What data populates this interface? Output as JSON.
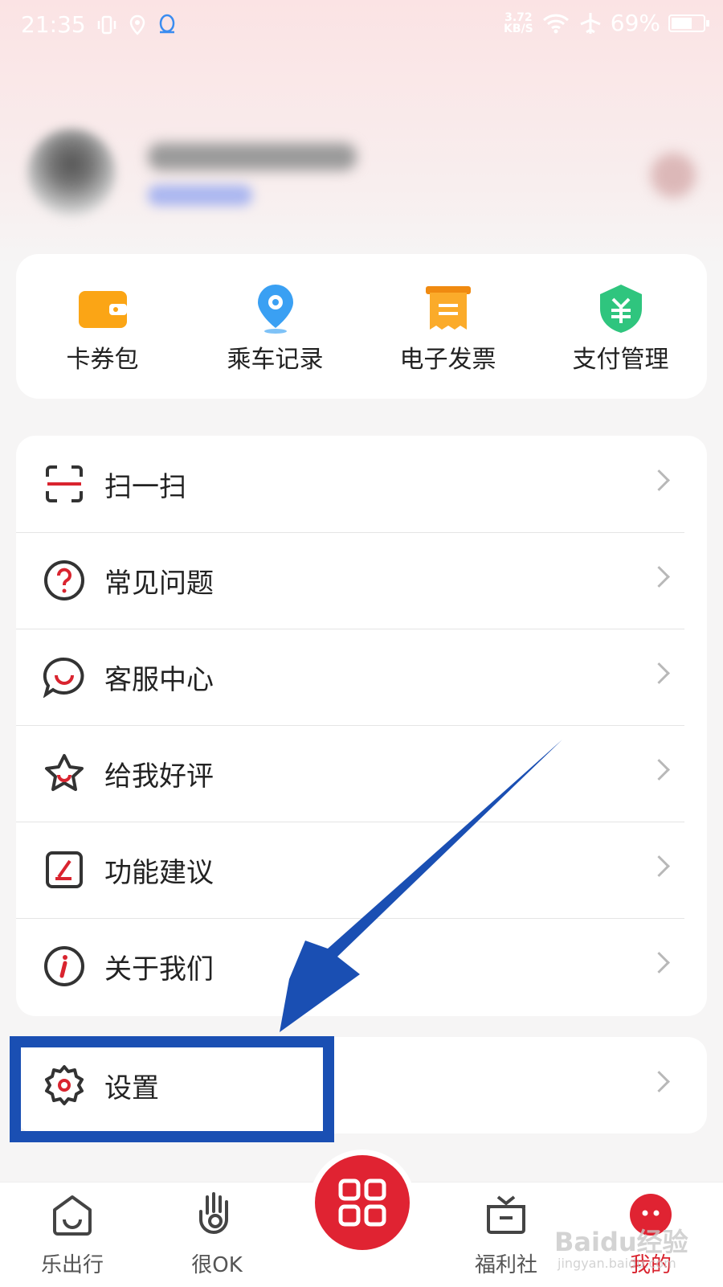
{
  "status": {
    "time": "21:35",
    "net_speed": "3.72",
    "net_unit": "KB/S",
    "battery": "69%",
    "battery_level": 0.69
  },
  "quick_actions": [
    {
      "label": "卡券包",
      "icon": "wallet-icon"
    },
    {
      "label": "乘车记录",
      "icon": "location-pin-icon"
    },
    {
      "label": "电子发票",
      "icon": "invoice-icon"
    },
    {
      "label": "支付管理",
      "icon": "payment-shield-icon"
    }
  ],
  "menu": [
    {
      "label": "扫一扫",
      "icon": "scan-icon"
    },
    {
      "label": "常见问题",
      "icon": "question-icon"
    },
    {
      "label": "客服中心",
      "icon": "customer-service-icon"
    },
    {
      "label": "给我好评",
      "icon": "star-icon"
    },
    {
      "label": "功能建议",
      "icon": "edit-icon"
    },
    {
      "label": "关于我们",
      "icon": "info-icon"
    }
  ],
  "settings": {
    "label": "设置",
    "icon": "gear-icon"
  },
  "tabs": [
    {
      "label": "乐出行",
      "icon": "home-icon"
    },
    {
      "label": "很OK",
      "icon": "ok-hand-icon"
    },
    {
      "label": "福利社",
      "icon": "gift-box-icon"
    },
    {
      "label": "我的",
      "icon": "profile-face-icon",
      "active": true
    }
  ],
  "center_button": {
    "icon": "qr-code-icon"
  },
  "colors": {
    "accent": "#d9242f",
    "annotation": "#1a4fb3"
  },
  "watermark": {
    "text": "Baidu经验",
    "sub": "jingyan.baidu.com"
  }
}
